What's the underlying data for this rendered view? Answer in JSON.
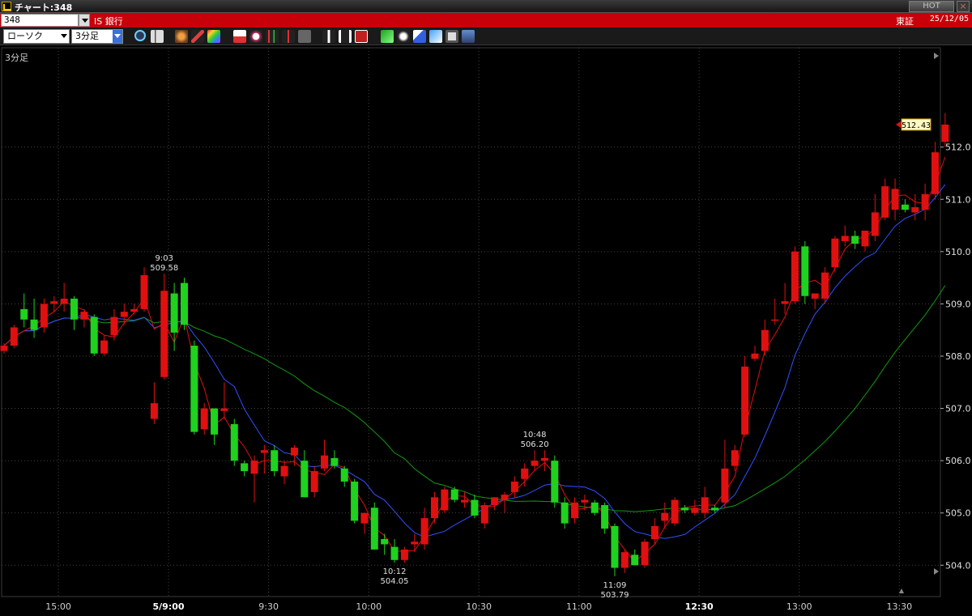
{
  "window": {
    "title": "チャート:348",
    "hot_label": "HOT",
    "close_label": "×"
  },
  "infobar": {
    "code": "348",
    "stock_name": "IS 銀行",
    "market": "東証",
    "date": "25/12/05"
  },
  "toolbar": {
    "chart_style": "ローソク",
    "interval": "3分足"
  },
  "chart_data": {
    "type": "candlestick",
    "period_label": "3分足",
    "ylim": [
      503.4,
      513.9
    ],
    "yticks": [
      504.0,
      505.0,
      506.0,
      507.0,
      508.0,
      509.0,
      510.0,
      511.0,
      512.0
    ],
    "xticks": [
      "15:00",
      "5/9:00",
      "9:30",
      "10:00",
      "10:30",
      "11:00",
      "12:30",
      "13:00",
      "13:30"
    ],
    "last_price": "512.43",
    "annotations": [
      {
        "time": "9:03",
        "value": "509.58"
      },
      {
        "time": "10:12",
        "value": "504.05"
      },
      {
        "time": "10:48",
        "value": "506.20"
      },
      {
        "time": "11:09",
        "value": "503.79"
      }
    ],
    "colors": {
      "up": "#e01010",
      "down": "#1ed21e",
      "ma_short": "#e01010",
      "ma_mid": "#3050ff",
      "ma_long": "#129a12"
    },
    "candles": [
      [
        508.1,
        508.25,
        508.05,
        508.2
      ],
      [
        508.2,
        508.6,
        508.15,
        508.55
      ],
      [
        508.9,
        509.2,
        508.55,
        508.7
      ],
      [
        508.7,
        509.1,
        508.35,
        508.5
      ],
      [
        508.55,
        509.1,
        508.45,
        509.0
      ],
      [
        509.0,
        509.15,
        508.85,
        509.05
      ],
      [
        509.0,
        509.4,
        508.85,
        509.1
      ],
      [
        509.1,
        509.15,
        508.5,
        508.7
      ],
      [
        508.7,
        508.9,
        508.55,
        508.85
      ],
      [
        508.75,
        508.8,
        508.0,
        508.05
      ],
      [
        508.05,
        508.4,
        508.0,
        508.3
      ],
      [
        508.4,
        508.9,
        508.3,
        508.75
      ],
      [
        508.75,
        509.0,
        508.6,
        508.85
      ],
      [
        508.85,
        509.0,
        508.8,
        508.9
      ],
      [
        508.9,
        509.7,
        508.85,
        509.55
      ],
      [
        506.8,
        507.5,
        506.7,
        507.1
      ],
      [
        507.6,
        509.58,
        507.55,
        509.25
      ],
      [
        509.2,
        509.4,
        508.1,
        508.45
      ],
      [
        509.4,
        509.5,
        508.5,
        508.6
      ],
      [
        508.2,
        508.3,
        506.5,
        506.55
      ],
      [
        506.6,
        507.1,
        506.5,
        507.0
      ],
      [
        507.0,
        507.0,
        506.3,
        506.5
      ],
      [
        506.95,
        507.5,
        506.8,
        507.0
      ],
      [
        506.7,
        506.8,
        505.9,
        506.0
      ],
      [
        505.95,
        506.0,
        505.7,
        505.8
      ],
      [
        505.75,
        506.1,
        505.2,
        506.0
      ],
      [
        506.15,
        506.3,
        505.75,
        506.2
      ],
      [
        506.2,
        506.3,
        505.7,
        505.8
      ],
      [
        505.7,
        506.0,
        505.55,
        505.9
      ],
      [
        506.1,
        506.3,
        505.9,
        506.25
      ],
      [
        506.0,
        506.2,
        505.3,
        505.3
      ],
      [
        505.4,
        505.9,
        505.3,
        505.8
      ],
      [
        505.85,
        506.4,
        505.8,
        506.1
      ],
      [
        506.05,
        506.2,
        505.85,
        505.9
      ],
      [
        505.85,
        505.9,
        505.5,
        505.6
      ],
      [
        505.6,
        505.65,
        504.8,
        504.85
      ],
      [
        504.8,
        505.0,
        504.6,
        505.0
      ],
      [
        505.1,
        505.2,
        504.3,
        504.3
      ],
      [
        504.5,
        504.6,
        504.2,
        504.4
      ],
      [
        504.35,
        504.5,
        504.05,
        504.1
      ],
      [
        504.1,
        504.35,
        504.05,
        504.3
      ],
      [
        504.4,
        504.6,
        504.25,
        504.45
      ],
      [
        504.4,
        505.1,
        504.3,
        504.9
      ],
      [
        504.9,
        505.4,
        504.8,
        505.3
      ],
      [
        505.05,
        505.5,
        505.0,
        505.45
      ],
      [
        505.45,
        505.5,
        505.2,
        505.25
      ],
      [
        505.2,
        505.4,
        505.1,
        505.25
      ],
      [
        505.25,
        505.35,
        504.9,
        504.95
      ],
      [
        504.8,
        505.2,
        504.7,
        505.15
      ],
      [
        505.15,
        505.3,
        505.05,
        505.3
      ],
      [
        505.25,
        505.4,
        505.0,
        505.35
      ],
      [
        505.4,
        505.7,
        505.3,
        505.6
      ],
      [
        505.65,
        505.95,
        505.5,
        505.85
      ],
      [
        505.9,
        506.2,
        505.8,
        506.0
      ],
      [
        506.0,
        506.2,
        505.8,
        506.05
      ],
      [
        506.0,
        506.1,
        505.1,
        505.2
      ],
      [
        505.2,
        505.3,
        504.7,
        504.8
      ],
      [
        504.9,
        505.3,
        504.8,
        505.2
      ],
      [
        505.2,
        505.35,
        505.05,
        505.25
      ],
      [
        505.2,
        505.25,
        504.95,
        505.0
      ],
      [
        505.15,
        505.2,
        504.6,
        504.7
      ],
      [
        504.75,
        504.8,
        503.79,
        503.95
      ],
      [
        503.95,
        504.3,
        503.85,
        504.25
      ],
      [
        504.2,
        504.3,
        504.0,
        504.0
      ],
      [
        504.0,
        504.5,
        503.95,
        504.45
      ],
      [
        504.5,
        504.9,
        504.4,
        504.75
      ],
      [
        504.85,
        505.2,
        504.7,
        505.0
      ],
      [
        504.8,
        505.3,
        504.75,
        505.25
      ],
      [
        505.1,
        505.15,
        505.0,
        505.05
      ],
      [
        505.0,
        505.25,
        504.95,
        505.1
      ],
      [
        505.0,
        505.5,
        504.9,
        505.3
      ],
      [
        505.1,
        505.15,
        505.0,
        505.05
      ],
      [
        505.2,
        506.4,
        505.1,
        505.85
      ],
      [
        505.9,
        506.3,
        505.8,
        506.2
      ],
      [
        506.5,
        508.0,
        506.45,
        507.8
      ],
      [
        507.95,
        508.2,
        507.9,
        508.05
      ],
      [
        508.1,
        508.7,
        508.0,
        508.5
      ],
      [
        508.7,
        509.1,
        508.6,
        508.7
      ],
      [
        509.0,
        509.4,
        508.8,
        509.05
      ],
      [
        509.05,
        510.1,
        509.0,
        510.0
      ],
      [
        510.1,
        510.2,
        509.0,
        509.15
      ],
      [
        509.1,
        509.15,
        508.9,
        509.2
      ],
      [
        509.1,
        509.7,
        509.0,
        509.6
      ],
      [
        509.7,
        510.3,
        509.6,
        510.25
      ],
      [
        510.2,
        510.5,
        510.1,
        510.3
      ],
      [
        510.3,
        510.4,
        510.05,
        510.15
      ],
      [
        510.1,
        510.4,
        510.0,
        510.4
      ],
      [
        510.3,
        511.1,
        510.2,
        510.75
      ],
      [
        510.65,
        511.4,
        510.6,
        511.25
      ],
      [
        510.8,
        511.4,
        510.6,
        511.2
      ],
      [
        510.9,
        511.0,
        510.75,
        510.8
      ],
      [
        510.75,
        511.1,
        510.6,
        510.85
      ],
      [
        510.8,
        511.3,
        510.6,
        511.1
      ],
      [
        511.1,
        512.1,
        511.0,
        511.9
      ],
      [
        512.1,
        512.65,
        512.0,
        512.43
      ]
    ]
  }
}
